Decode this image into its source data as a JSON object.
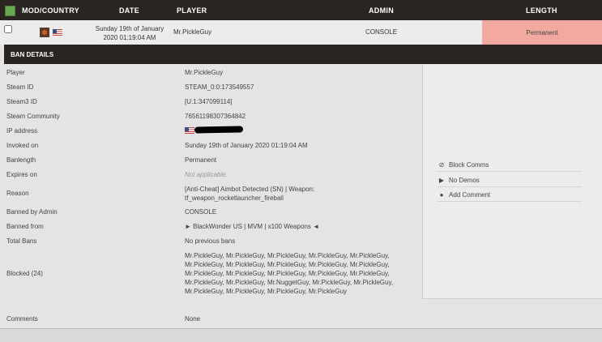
{
  "header": {
    "mod_country": "MOD/COUNTRY",
    "date": "DATE",
    "player": "PLAYER",
    "admin": "ADMIN",
    "length": "LENGTH"
  },
  "row": {
    "date_line1": "Sunday 19th of January",
    "date_line2": "2020 01:19:04 AM",
    "player": "Mr.PickleGuy",
    "admin": "CONSOLE",
    "length": "Permanent",
    "length_color": "#f2a9a0"
  },
  "details": {
    "title": "BAN DETAILS",
    "fields": {
      "player_label": "Player",
      "player": "Mr.PickleGuy",
      "steamid_label": "Steam ID",
      "steamid": "STEAM_0:0:173549557",
      "steam3_label": "Steam3 ID",
      "steam3": "[U:1:347099114]",
      "community_label": "Steam Community",
      "community": "76561198307364842",
      "ip_label": "IP address",
      "invoked_label": "Invoked on",
      "invoked": "Sunday 19th of January 2020 01:19:04 AM",
      "banlength_label": "Banlength",
      "banlength": "Permanent",
      "expires_label": "Expires on",
      "expires": "Not applicable.",
      "reason_label": "Reason",
      "reason_line1": "[Anti-Cheat] Aimbot Detected (SN) | Weapon:",
      "reason_line2": "tf_weapon_rocketlauncher_fireball",
      "banned_by_label": "Banned by Admin",
      "banned_by": "CONSOLE",
      "banned_from_label": "Banned from",
      "banned_from": "► BlackWonder US | MVM | x100 Weapons ◄",
      "total_bans_label": "Total Bans",
      "total_bans": "No previous bans",
      "blocked_label": "Blocked (24)",
      "blocked_lines": [
        "Mr.PickleGuy, Mr.PickleGuy, Mr.PickleGuy, Mr.PickleGuy, Mr.PickleGuy,",
        "Mr.PickleGuy, Mr.PickleGuy, Mr.PickleGuy, Mr.PickleGuy, Mr.PickleGuy,",
        "Mr.PickleGuy, Mr.PickleGuy, Mr.PickleGuy, Mr.PickleGuy, Mr.PickleGuy,",
        "Mr.PickleGuy, Mr.PickleGuy, Mr.NuggetGuy, Mr.PickleGuy, Mr.PickleGuy,",
        "Mr.PickleGuy, Mr.PickleGuy, Mr.PickleGuy, Mr.PickleGuy"
      ],
      "comments_label": "Comments",
      "comments": "None"
    }
  },
  "actions": {
    "block_comms": "Block Comms",
    "no_demos": "No Demos",
    "add_comment": "Add Comment"
  }
}
